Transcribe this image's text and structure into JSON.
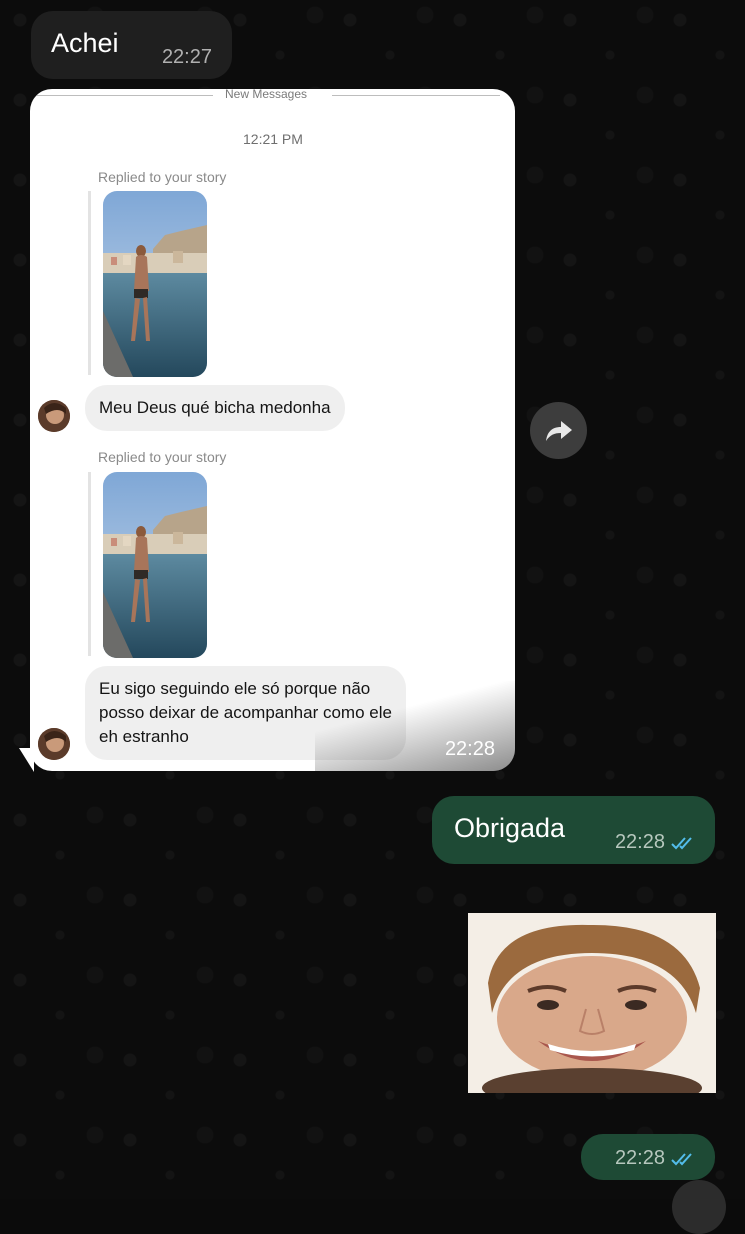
{
  "messages": {
    "incoming_text": {
      "text": "Achei",
      "time": "22:27"
    },
    "screenshot": {
      "new_messages_label": "New Messages",
      "time_label": "12:21 PM",
      "replied_label_1": "Replied to your story",
      "message_1": "Meu Deus qué bicha medonha",
      "replied_label_2": "Replied to your story",
      "message_2": "Eu sigo seguindo ele só porque não\nposso deixar de acompanhar como ele\neh estranho",
      "time": "22:28"
    },
    "outgoing_text": {
      "text": "Obrigada",
      "time": "22:28"
    },
    "outgoing_sticker": {
      "time": "22:28"
    }
  },
  "colors": {
    "outgoing_bubble": "#1e4a35",
    "incoming_bubble": "#1f1f1f",
    "read_ticks": "#53bdeb"
  },
  "icons": {
    "forward": "forward-icon",
    "read_receipt": "double-check-icon"
  }
}
